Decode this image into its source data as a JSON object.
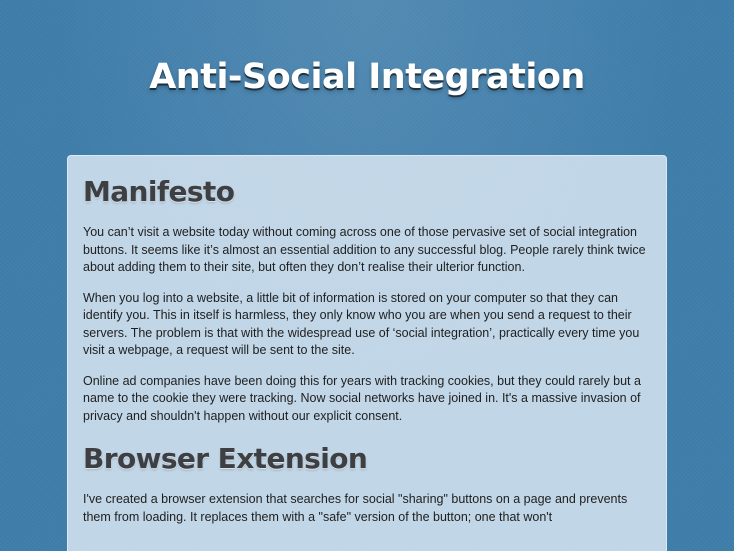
{
  "header": {
    "title": "Anti-Social Integration"
  },
  "sections": [
    {
      "heading": "Manifesto",
      "paragraphs": [
        "You can’t visit a website today without coming across one of those pervasive set of social integration buttons. It seems like it’s almost an essential addition to any successful blog. People rarely think twice about adding them to their site, but often they don’t realise their ulterior function.",
        "When you log into a website, a little bit of information is stored on your computer so that they can identify you. This in itself is harmless, they only know who you are when you send a request to their servers. The problem is that with the widespread use of ‘social integration’, practically every time you visit a webpage, a request will be sent to the site.",
        "Online ad companies have been doing this for years with tracking cookies, but they could rarely but a name to the cookie they were tracking. Now social networks have joined in. It's a massive invasion of privacy and shouldn't happen without our explicit consent."
      ]
    },
    {
      "heading": "Browser Extension",
      "paragraphs": [
        "I've created a browser extension that searches for social \"sharing\" buttons on a page and prevents them from loading. It replaces them with a \"safe\" version of the button; one that won't"
      ]
    }
  ],
  "colors": {
    "background": "#3f7eab",
    "card": "#d6e4f0",
    "heading": "#3d3f42",
    "text": "#1f1f1f",
    "title": "#ffffff"
  }
}
